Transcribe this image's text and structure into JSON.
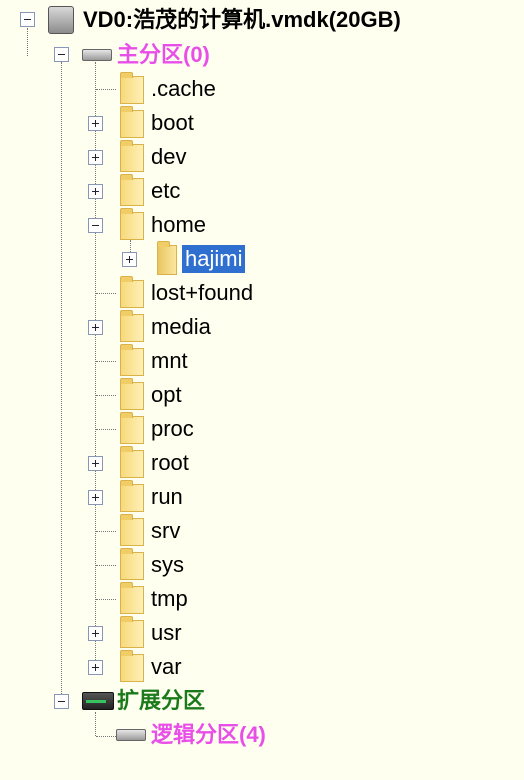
{
  "root": {
    "label": "VD0:浩茂的计算机.vmdk(20GB)",
    "icon": "virtual-disk-icon"
  },
  "primary": {
    "label": "主分区(0)",
    "icon": "drive-icon",
    "color": "#e84fe8"
  },
  "folders": [
    {
      "name": ".cache",
      "expander": "none"
    },
    {
      "name": "boot",
      "expander": "plus"
    },
    {
      "name": "dev",
      "expander": "plus"
    },
    {
      "name": "etc",
      "expander": "plus"
    },
    {
      "name": "home",
      "expander": "minus"
    },
    {
      "name": "lost+found",
      "expander": "none"
    },
    {
      "name": "media",
      "expander": "plus"
    },
    {
      "name": "mnt",
      "expander": "none"
    },
    {
      "name": "opt",
      "expander": "none"
    },
    {
      "name": "proc",
      "expander": "none"
    },
    {
      "name": "root",
      "expander": "plus"
    },
    {
      "name": "run",
      "expander": "plus"
    },
    {
      "name": "srv",
      "expander": "none"
    },
    {
      "name": "sys",
      "expander": "none"
    },
    {
      "name": "tmp",
      "expander": "none"
    },
    {
      "name": "usr",
      "expander": "plus"
    },
    {
      "name": "var",
      "expander": "plus"
    }
  ],
  "home_child": {
    "name": "hajimi",
    "selected": true,
    "selection_color": "#2f6fd0"
  },
  "extended": {
    "label": "扩展分区",
    "icon": "extended-partition-icon",
    "color": "#1a7a1a"
  },
  "logical": {
    "label": "逻辑分区(4)",
    "icon": "drive-icon",
    "color": "#e84fe8"
  }
}
